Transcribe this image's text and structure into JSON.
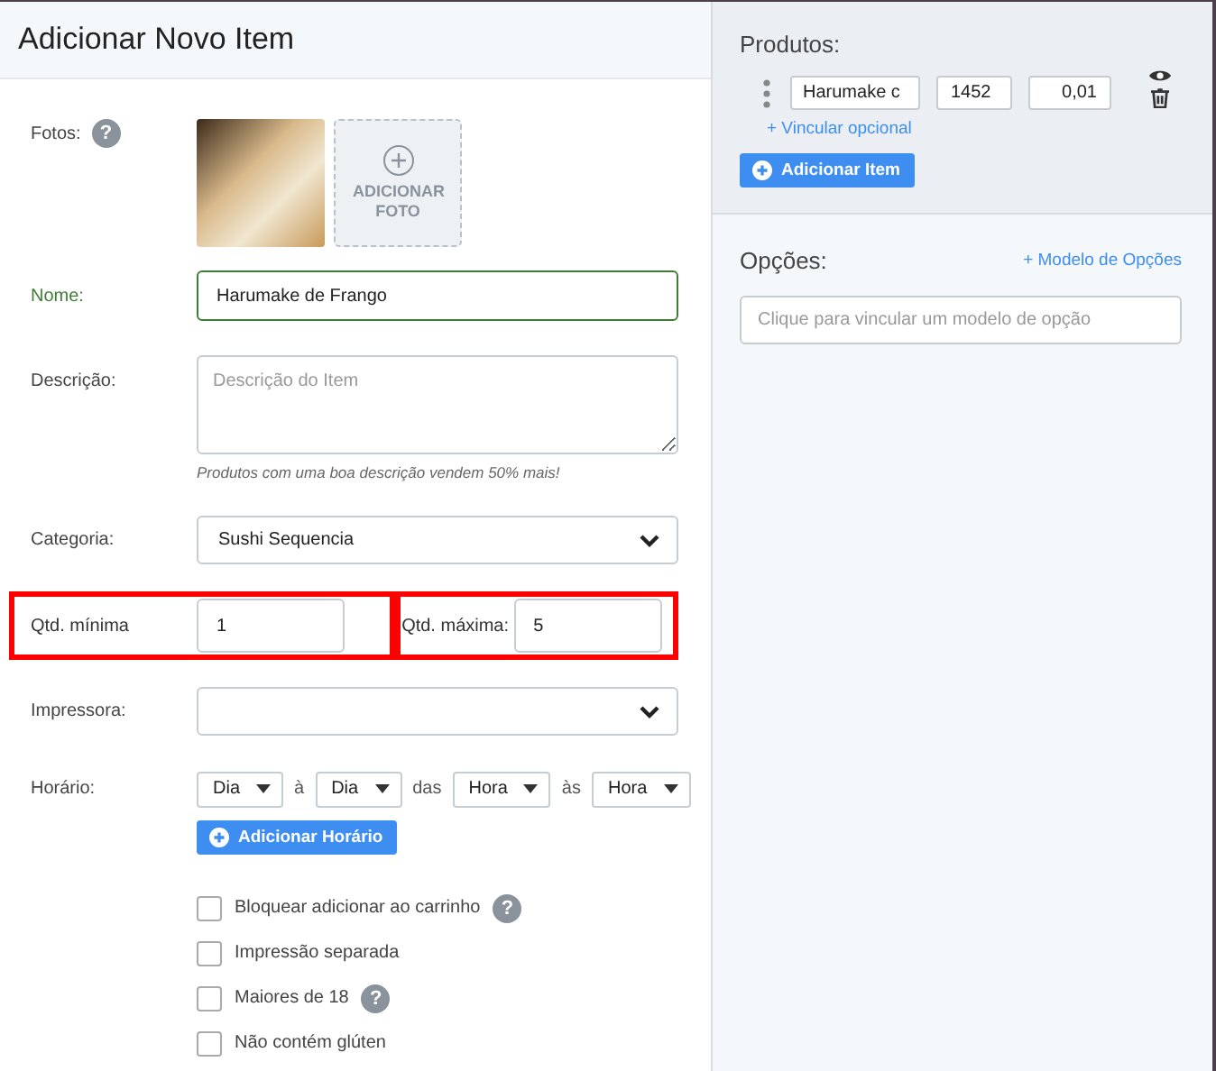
{
  "title": "Adicionar Novo Item",
  "photos": {
    "label": "Fotos:",
    "help": "?",
    "add_label": "ADICIONAR FOTO"
  },
  "name": {
    "label": "Nome:",
    "value": "Harumake de Frango",
    "focused": true
  },
  "description": {
    "label": "Descrição:",
    "placeholder": "Descrição do Item",
    "hint": "Produtos com uma boa descrição vendem 50% mais!"
  },
  "category": {
    "label": "Categoria:",
    "value": "Sushi Sequencia"
  },
  "qty_min": {
    "label": "Qtd. mínima",
    "value": "1",
    "highlighted": true
  },
  "qty_max": {
    "label": "Qtd. máxima:",
    "value": "5",
    "highlighted": true
  },
  "printer": {
    "label": "Impressora:"
  },
  "schedule": {
    "label": "Horário:",
    "parts": [
      {
        "kind": "select",
        "value": "Dia"
      },
      {
        "kind": "text",
        "value": "à"
      },
      {
        "kind": "select",
        "value": "Dia"
      },
      {
        "kind": "text",
        "value": "das"
      },
      {
        "kind": "select",
        "value": "Hora"
      },
      {
        "kind": "text",
        "value": "às"
      },
      {
        "kind": "select",
        "value": "Hora"
      }
    ],
    "add_button": "Adicionar Horário"
  },
  "checkboxes": [
    {
      "label": "Bloquear adicionar ao carrinho",
      "checked": false,
      "help": "?"
    },
    {
      "label": "Impressão separada",
      "checked": false
    },
    {
      "label": "Maiores de 18",
      "checked": false,
      "help": "?"
    },
    {
      "label": "Não contém glúten",
      "checked": false
    }
  ],
  "products": {
    "title": "Produtos:",
    "items": [
      {
        "name": "Harumake c",
        "code": "1452",
        "price": "0,01",
        "link": "+ Vincular opcional"
      }
    ],
    "add_button": "Adicionar Item"
  },
  "options": {
    "title": "Opções:",
    "link": "+ Modelo de Opções",
    "placeholder": "Clique para vincular um modelo de opção"
  }
}
